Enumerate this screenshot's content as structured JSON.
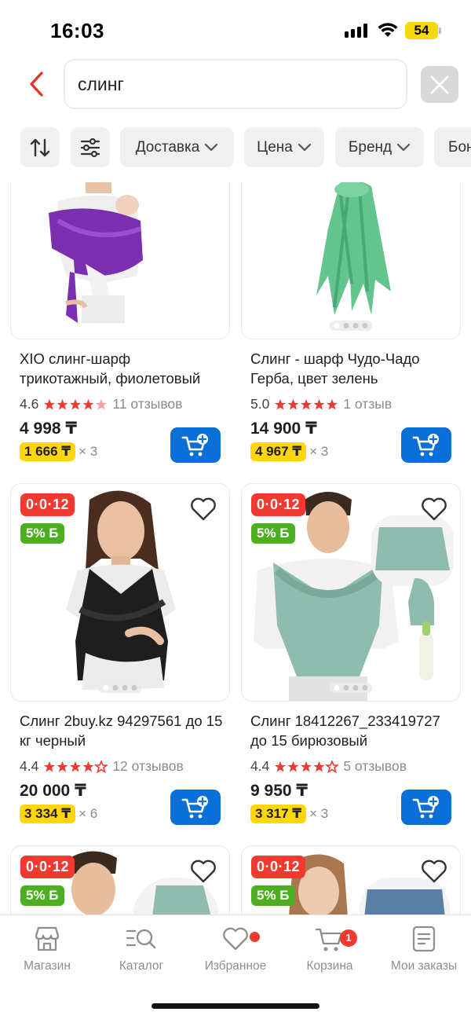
{
  "status_bar": {
    "time": "16:03",
    "battery": "54"
  },
  "search": {
    "query": "слинг",
    "placeholder": ""
  },
  "filters": [
    {
      "label": "Доставка"
    },
    {
      "label": "Цена"
    },
    {
      "label": "Бренд"
    },
    {
      "label": "Бон"
    }
  ],
  "products": [
    {
      "title": "XIO слинг-шарф трикотажный, фиолетовый",
      "rating": "4.6",
      "reviews": "11 отзывов",
      "price": "4 998 ₸",
      "installment": "1 666 ₸",
      "installment_mult": "× 3",
      "image": "woman-purple-sling-photo"
    },
    {
      "title": "Слинг - шарф Чудо-Чадо Герба, цвет зелень",
      "rating": "5.0",
      "reviews": "1 отзыв",
      "price": "14 900 ₸",
      "installment": "4 967 ₸",
      "installment_mult": "× 3",
      "image": "green-scarf-sling-photo"
    },
    {
      "title": "Слинг 2buy.kz 94297561 до 15 кг черный",
      "rating": "4.4",
      "reviews": "12 отзывов",
      "price": "20 000 ₸",
      "installment": "3 334 ₸",
      "installment_mult": "× 6",
      "promo_badge": "0·0·12",
      "bonus_badge": "5% Б",
      "image": "woman-black-sling-photo"
    },
    {
      "title": "Слинг 18412267_233419727 до 15 бирюзовый",
      "rating": "4.4",
      "reviews": "5 отзывов",
      "price": "9 950 ₸",
      "installment": "3 317 ₸",
      "installment_mult": "× 3",
      "promo_badge": "0·0·12",
      "bonus_badge": "5% Б",
      "image": "man-turquoise-sling-photo"
    },
    {
      "promo_badge": "0·0·12",
      "bonus_badge": "5% Б",
      "image": "man-sling-photo"
    },
    {
      "promo_badge": "0·0·12",
      "bonus_badge": "5% Б",
      "image": "woman-blue-sling-photo"
    }
  ],
  "nav": [
    {
      "label": "Магазин",
      "icon": "store-icon"
    },
    {
      "label": "Каталог",
      "icon": "catalog-search-icon"
    },
    {
      "label": "Избранное",
      "icon": "heart-icon"
    },
    {
      "label": "Корзина",
      "icon": "cart-icon",
      "badge": "1"
    },
    {
      "label": "Мои заказы",
      "icon": "orders-icon"
    }
  ],
  "colors": {
    "accent_red": "#f03a2f",
    "cart_blue": "#0a6fd6",
    "installment_yellow": "#ffd60a",
    "bonus_green": "#4caf20"
  }
}
